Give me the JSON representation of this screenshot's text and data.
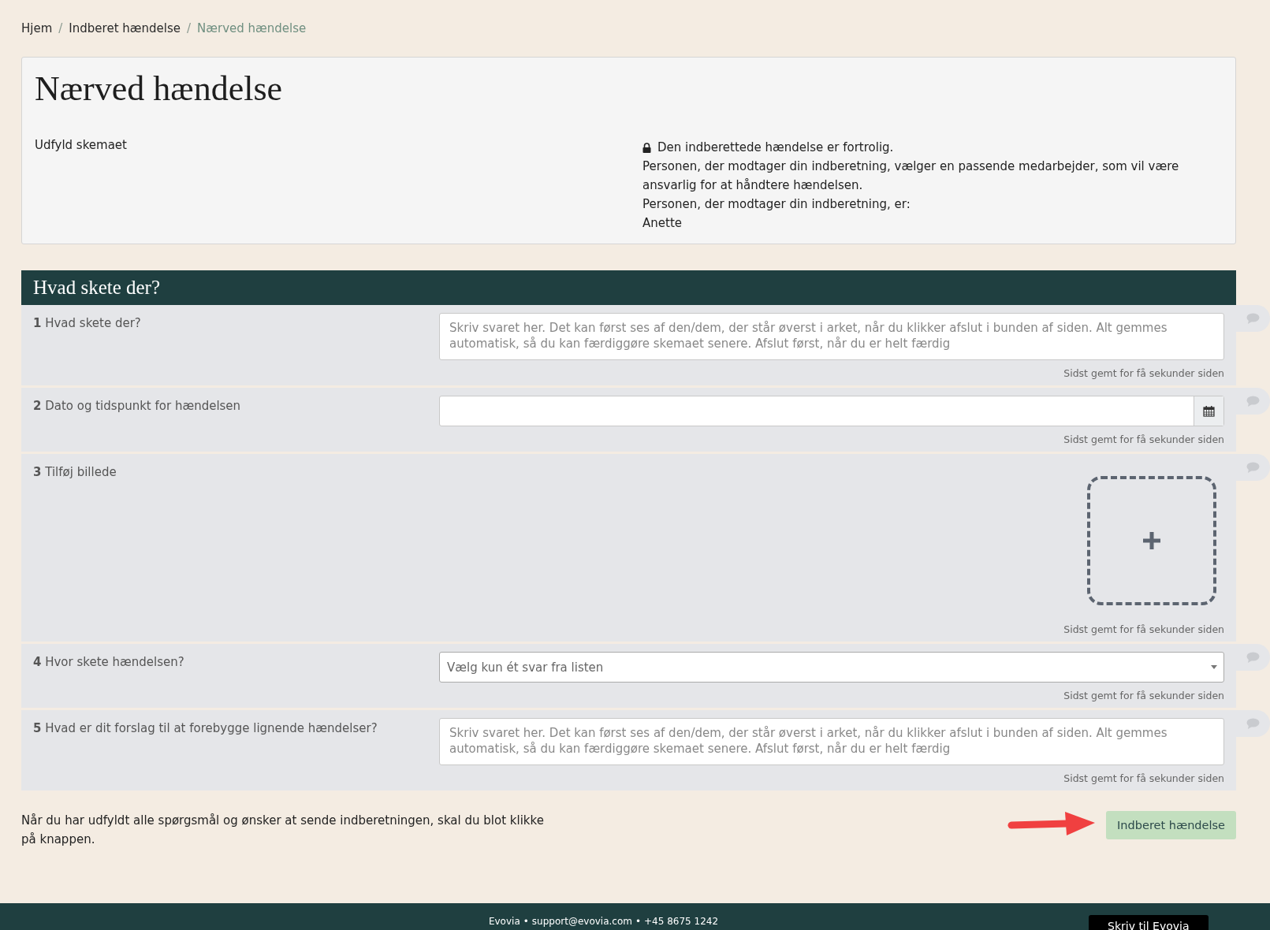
{
  "breadcrumb": [
    {
      "label": "Hjem",
      "current": false
    },
    {
      "separator": "/",
      "label": "Indberet hændelse",
      "current": false
    },
    {
      "separator": "/",
      "label": "Nærved hændelse",
      "current": true
    }
  ],
  "intro": {
    "title": "Nærved hændelse",
    "subtitle": "Udfyld skemaet",
    "confidential": "Den indberettede hændelse er fortrolig.",
    "lines": [
      "Personen, der modtager din indberetning, vælger en passende medarbejder, som vil være ansvarlig for at håndtere hændelsen.",
      "Personen, der modtager din indberetning, er:",
      "Anette"
    ]
  },
  "section": {
    "title": "Hvad skete der?",
    "questions": [
      {
        "number": "1",
        "label": "Hvad skete der?",
        "kind": "textarea",
        "placeholder": "Skriv svaret her. Det kan først ses af den/dem, der står øverst i arket, når du klikker afslut i bunden af siden. Alt gemmes automatisk, så du kan færdiggøre skemaet senere. Afslut først, når du er helt færdig",
        "saved": "Sidst gemt for få sekunder siden"
      },
      {
        "number": "2",
        "label": "Dato og tidspunkt for hændelsen",
        "kind": "datetime",
        "saved": "Sidst gemt for få sekunder siden"
      },
      {
        "number": "3",
        "label": "Tilføj billede",
        "kind": "image",
        "saved": "Sidst gemt for få sekunder siden"
      },
      {
        "number": "4",
        "label": "Hvor skete hændelsen?",
        "kind": "select",
        "placeholder": "Vælg kun ét svar fra listen",
        "saved": "Sidst gemt for få sekunder siden"
      },
      {
        "number": "5",
        "label": "Hvad er dit forslag til at forebygge lignende hændelser?",
        "kind": "textarea",
        "placeholder": "Skriv svaret her. Det kan først ses af den/dem, der står øverst i arket, når du klikker afslut i bunden af siden. Alt gemmes automatisk, så du kan færdiggøre skemaet senere. Afslut først, når du er helt færdig",
        "saved": "Sidst gemt for få sekunder siden"
      }
    ]
  },
  "submit": {
    "text": "Når du har udfyldt alle spørgsmål og ønsker at sende indberetningen, skal du blot klikke på knappen.",
    "button": "Indberet hændelse"
  },
  "footer": {
    "company": "Evovia",
    "email": "support@evovia.com",
    "phone": "+45 8675 1242",
    "separator": "•",
    "contact_button": "Skriv til Evovia"
  }
}
